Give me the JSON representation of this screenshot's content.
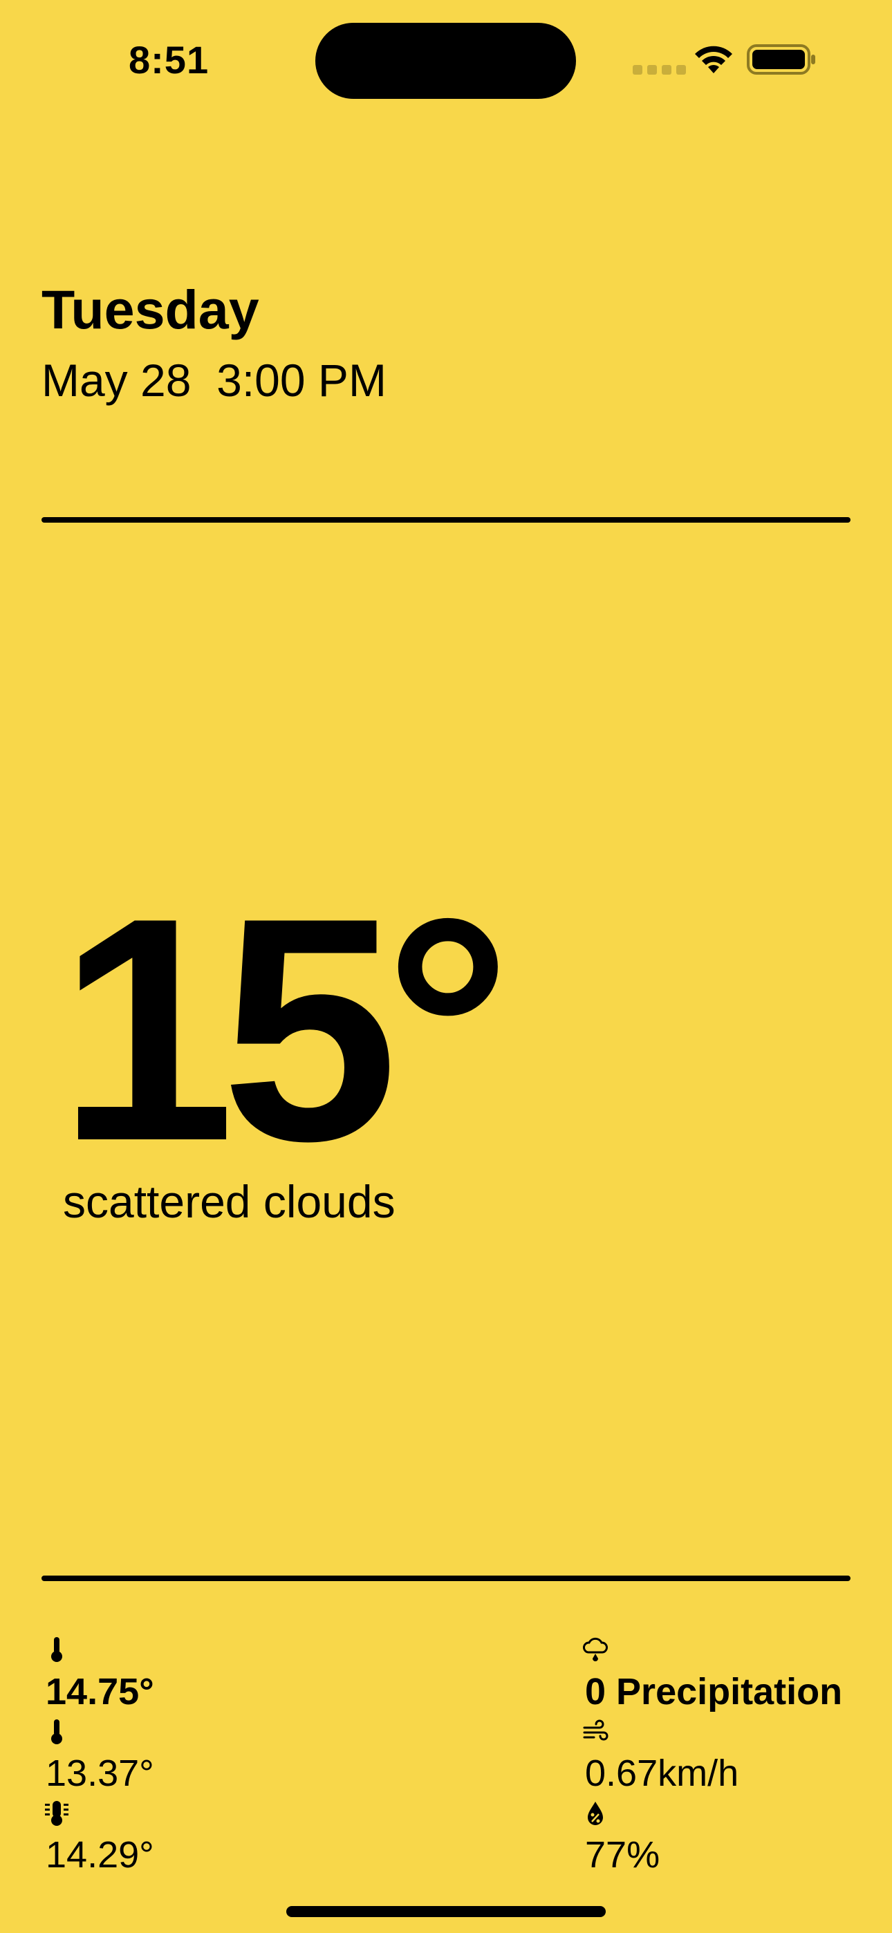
{
  "status_bar": {
    "time": "8:51"
  },
  "header": {
    "day": "Tuesday",
    "date": "May 28",
    "time": "3:00 PM"
  },
  "main": {
    "temperature": "15°",
    "condition": "scattered clouds"
  },
  "details": {
    "left": [
      {
        "icon": "thermometer-icon",
        "value": "14.75°"
      },
      {
        "icon": "thermometer-low-icon",
        "value": "13.37°"
      },
      {
        "icon": "thermometer-feels-like-icon",
        "value": "14.29°"
      }
    ],
    "right": [
      {
        "icon": "cloud-rain-icon",
        "value": "0 Precipitation"
      },
      {
        "icon": "wind-icon",
        "value": "0.67km/h"
      },
      {
        "icon": "humidity-drop-icon",
        "value": "77%"
      }
    ]
  },
  "colors": {
    "background": "#F8D74A",
    "foreground": "#000000"
  }
}
